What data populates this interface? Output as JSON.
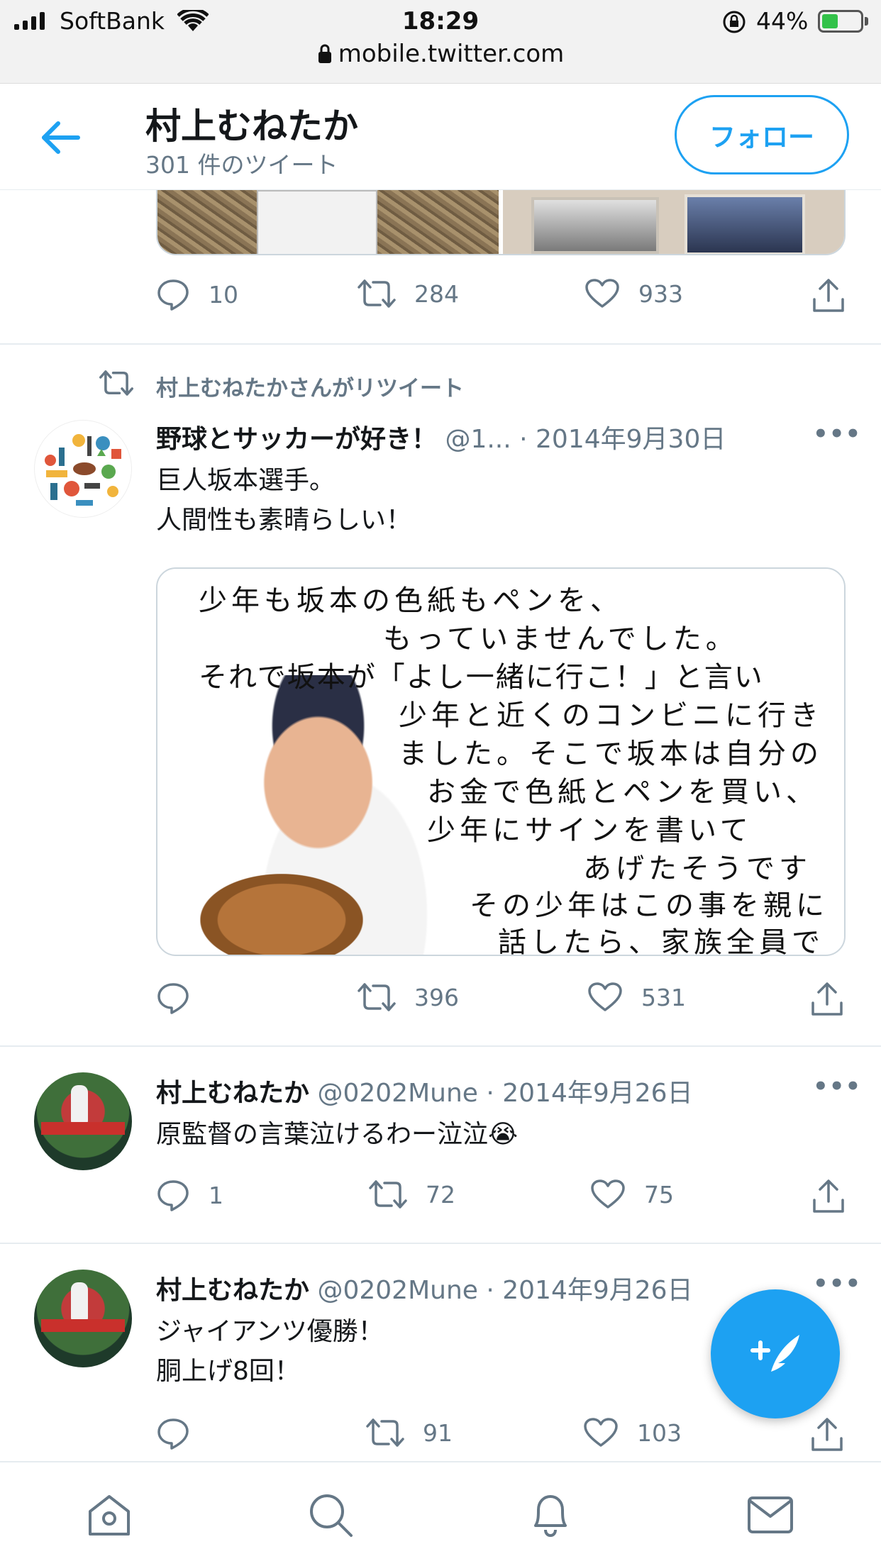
{
  "status_bar": {
    "carrier": "SoftBank",
    "time": "18:29",
    "battery_percent": "44%"
  },
  "url_bar": {
    "url": "mobile.twitter.com"
  },
  "header": {
    "name": "村上むねたか",
    "tweet_count": "301 件のツイート",
    "follow_label": "フォロー"
  },
  "tweets": [
    {
      "replies": "10",
      "retweets": "284",
      "likes": "933"
    },
    {
      "retweeted_by": "村上むねたかさんがリツイート",
      "name": "野球とサッカーが好き！",
      "meta": " @1... · 2014年9月30日",
      "text": "巨人坂本選手。\n人間性も素晴らしい！",
      "image_text": [
        "少年も坂本の色紙もペンを、",
        "もっていませんでした。",
        "それで坂本が「よし一緒に行こ！」と言い",
        "少年と近くのコンビニに行き",
        "ました。そこで坂本は自分の",
        "お金で色紙とペンを買い、",
        "少年にサインを書いて",
        "あげたそうです",
        "その少年はこの事を親に",
        "話したら、家族全員で"
      ],
      "replies": "",
      "retweets": "396",
      "likes": "531"
    },
    {
      "name": "村上むねたか",
      "meta": " @0202Mune · 2014年9月26日",
      "text": "原監督の言葉泣けるわー泣泣😭",
      "replies": "1",
      "retweets": "72",
      "likes": "75"
    },
    {
      "name": "村上むねたか",
      "meta": " @0202Mune · 2014年9月26日",
      "text": "ジャイアンツ優勝！\n胴上げ8回！",
      "replies": "",
      "retweets": "91",
      "likes": "103"
    }
  ],
  "more_label": "•••",
  "colors": {
    "brand": "#1da1f2",
    "secondary_text": "#657786",
    "divider": "#e6ecf0"
  },
  "icons": [
    "back-arrow-icon",
    "reply-icon",
    "retweet-icon",
    "like-icon",
    "share-icon",
    "compose-icon",
    "home-icon",
    "search-icon",
    "bell-icon",
    "mail-icon"
  ]
}
